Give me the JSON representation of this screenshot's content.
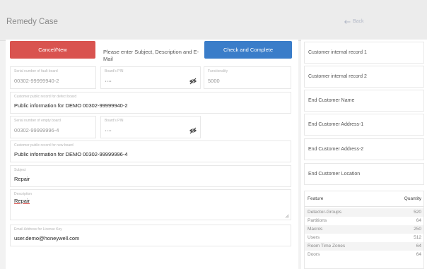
{
  "header": {
    "title": "Remedy Case",
    "back_label": "Back"
  },
  "actions": {
    "cancel_label": "Cancel/New",
    "hint": "Please enter Subject, Description and E-Mail",
    "complete_label": "Check and Complete"
  },
  "defect_board": {
    "serial_label": "Serial number of fault board",
    "serial_value": "00302-99999940-2",
    "pin_label": "Board's PIN",
    "pin_value": "····",
    "functionality_label": "Functionality",
    "functionality_value": "5000",
    "public_record_label": "Customer public record for defect board",
    "public_record_value": "Public information for DEMO 00302-99999940-2"
  },
  "new_board": {
    "serial_label": "Serial number of empty board",
    "serial_value": "00302-99999996-4",
    "pin_label": "Board's PIN",
    "pin_value": "····",
    "public_record_label": "Customer public record for new board",
    "public_record_value": "Public information for DEMO 00302-99999996-4"
  },
  "subject": {
    "label": "Subject",
    "value": "Repair"
  },
  "description": {
    "label": "Description",
    "value": "Repair"
  },
  "email": {
    "label": "Email Address for License Key",
    "value": "user.demo@honeywell.com"
  },
  "right_fields": [
    {
      "placeholder": "Customer internal record 1"
    },
    {
      "placeholder": "Customer internal record 2"
    },
    {
      "placeholder": "End Customer Name"
    },
    {
      "placeholder": "End Customer Address-1"
    },
    {
      "placeholder": "End Customer Address-2"
    },
    {
      "placeholder": "End Customer Location"
    }
  ],
  "features": {
    "headers": [
      "Feature",
      "Quantity"
    ],
    "rows": [
      [
        "Detector-Groups",
        "520"
      ],
      [
        "Partitions",
        "64"
      ],
      [
        "Macros",
        "250"
      ],
      [
        "Users",
        "512"
      ],
      [
        "Room Time Zones",
        "64"
      ],
      [
        "Doors",
        "64"
      ]
    ]
  },
  "colors": {
    "cancel": "#d9534f",
    "complete": "#3a7dc9",
    "back": "#b2b8c6"
  },
  "icons": {
    "back": "arrow-left-icon",
    "pin_toggle": "eye-slash-icon"
  }
}
